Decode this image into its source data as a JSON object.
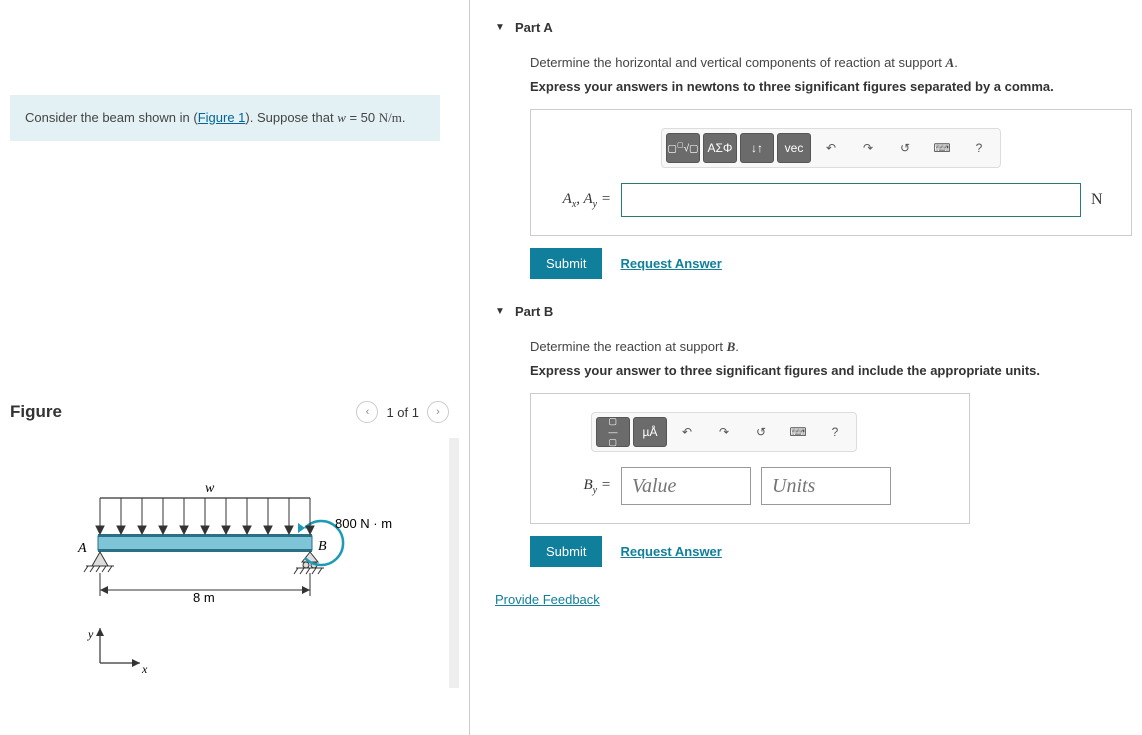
{
  "problem": {
    "text_pre": "Consider the beam shown in (",
    "figure_link": "Figure 1",
    "text_mid": "). Suppose that ",
    "var": "w",
    "eq": " = 50 ",
    "unit": "N/m",
    "text_post": "."
  },
  "figure": {
    "title": "Figure",
    "pager": "1 of 1",
    "load_label": "w",
    "moment_label": "800 N · m",
    "point_a": "A",
    "point_b": "B",
    "span": "8 m",
    "axis_x": "x",
    "axis_y": "y"
  },
  "partA": {
    "title": "Part A",
    "instruction_pre": "Determine the horizontal and vertical components of reaction at support ",
    "instruction_var": "A",
    "instruction_post": ".",
    "hint": "Express your answers in newtons to three significant figures separated by a comma.",
    "label_html": "Aₓ, Aᵧ =",
    "unit": "N",
    "toolbar": {
      "templates": "▢√▢",
      "greek": "ΑΣΦ",
      "updown": "↓↑",
      "vec": "vec",
      "undo": "↶",
      "redo": "↷",
      "reset": "↺",
      "keyboard": "⌨",
      "help": "?"
    },
    "submit": "Submit",
    "request": "Request Answer"
  },
  "partB": {
    "title": "Part B",
    "instruction_pre": "Determine the reaction at support ",
    "instruction_var": "B",
    "instruction_post": ".",
    "hint": "Express your answer to three significant figures and include the appropriate units.",
    "label": "Bᵧ =",
    "value_placeholder": "Value",
    "units_placeholder": "Units",
    "toolbar": {
      "templates": "▢÷▢",
      "units": "µÅ",
      "undo": "↶",
      "redo": "↷",
      "reset": "↺",
      "keyboard": "⌨",
      "help": "?"
    },
    "submit": "Submit",
    "request": "Request Answer"
  },
  "feedback": "Provide Feedback"
}
